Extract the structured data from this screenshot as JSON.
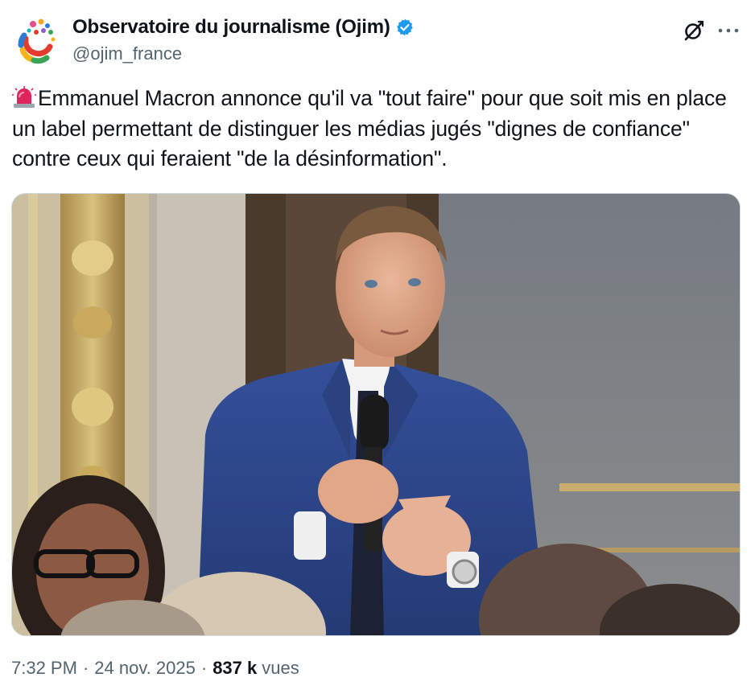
{
  "author": {
    "display_name": "Observatoire du journalisme (Ojim)",
    "handle": "@ojim_france",
    "verified": true,
    "verified_color": "#1d9bf0"
  },
  "header_icons": [
    "avatar-logo",
    "verified-badge-icon",
    "grok-icon",
    "more-options-icon"
  ],
  "tweet": {
    "emoji": "siren-icon",
    "text": "Emmanuel Macron annonce qu'il va \"tout faire\" pour que soit mis en place un label permettant de distinguer les médias jugés \"dignes de confiance\" contre ceux qui feraient \"de la désinformation\"."
  },
  "media": {
    "type": "photo"
  },
  "meta": {
    "time": "7:32 PM",
    "dot1": "·",
    "date": "24 nov. 2025",
    "dot2": "·",
    "views_count": "837 k",
    "views_label": "vues"
  },
  "colors": {
    "text": "#0f1419",
    "secondary": "#536471",
    "suit": "#2f4a8a"
  }
}
